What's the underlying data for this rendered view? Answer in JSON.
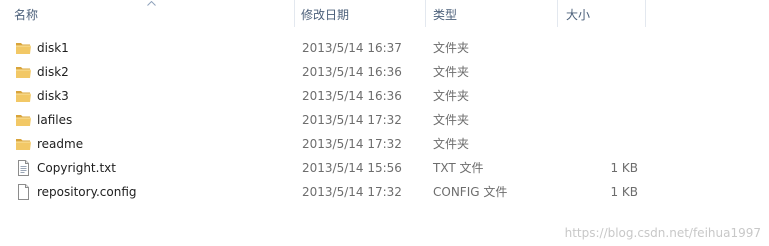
{
  "columns": {
    "name": "名称",
    "date": "修改日期",
    "type": "类型",
    "size": "大小"
  },
  "files": [
    {
      "icon": "folder-icon",
      "name": "disk1",
      "date": "2013/5/14 16:37",
      "type": "文件夹",
      "size": ""
    },
    {
      "icon": "folder-icon",
      "name": "disk2",
      "date": "2013/5/14 16:36",
      "type": "文件夹",
      "size": ""
    },
    {
      "icon": "folder-icon",
      "name": "disk3",
      "date": "2013/5/14 16:36",
      "type": "文件夹",
      "size": ""
    },
    {
      "icon": "folder-icon",
      "name": "lafiles",
      "date": "2013/5/14 17:32",
      "type": "文件夹",
      "size": ""
    },
    {
      "icon": "folder-icon",
      "name": "readme",
      "date": "2013/5/14 17:32",
      "type": "文件夹",
      "size": ""
    },
    {
      "icon": "text-file-icon",
      "name": "Copyright.txt",
      "date": "2013/5/14 15:56",
      "type": "TXT 文件",
      "size": "1 KB"
    },
    {
      "icon": "file-icon",
      "name": "repository.config",
      "date": "2013/5/14 17:32",
      "type": "CONFIG 文件",
      "size": "1 KB"
    }
  ],
  "watermark": "https://blog.csdn.net/feihua1997",
  "colors": {
    "header_text": "#4c607a",
    "folder": "#e8b64c",
    "secondary_text": "#6d6d6d"
  }
}
